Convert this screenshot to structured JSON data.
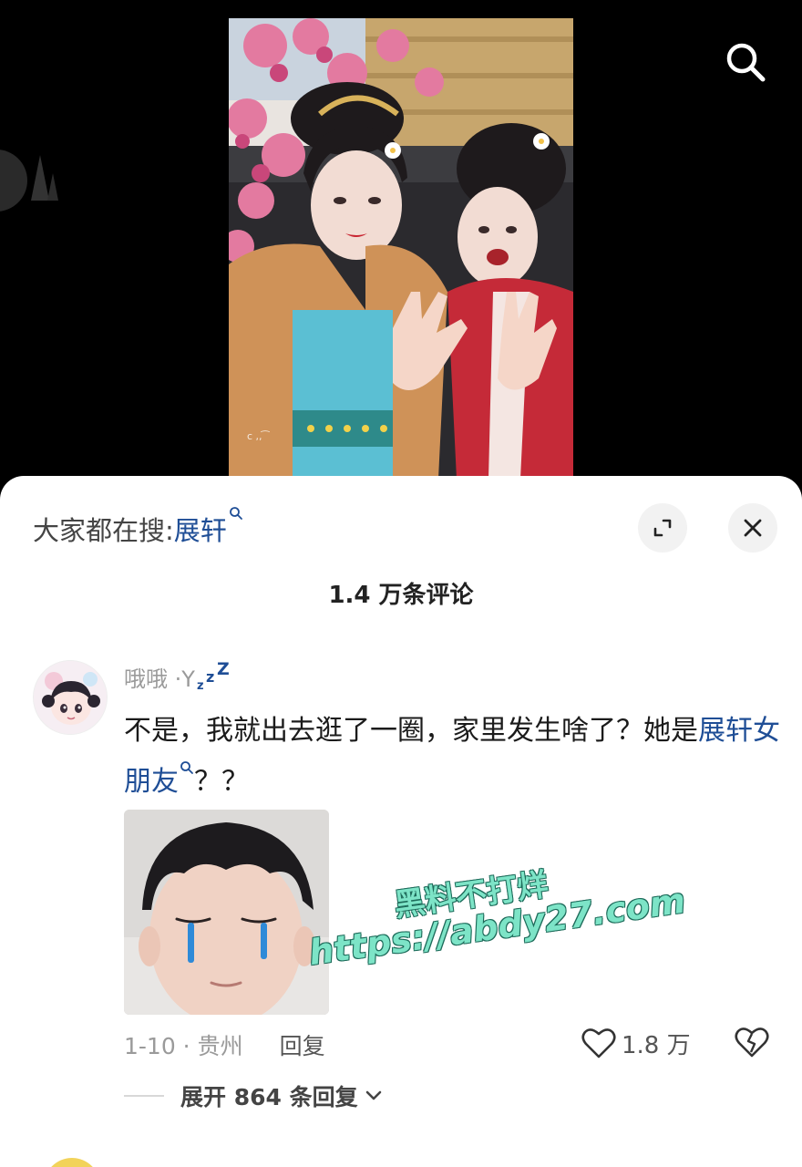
{
  "video": {
    "icons": {
      "search": "search-icon",
      "side_logo": "logo-icon"
    }
  },
  "comments_panel": {
    "hot_search": {
      "prefix": "大家都在搜:",
      "keyword": "展轩"
    },
    "buttons": {
      "expand": "expand-icon",
      "close": "close-icon"
    },
    "count_label": "1.4 万条评论"
  },
  "comment": {
    "username": "哦哦 ·Y",
    "username_emoji": "zzz-icon",
    "text_before": "不是，我就出去逛了一圈，家里发生啥了？她是",
    "text_keyword": "展轩女朋友",
    "text_after": "？？",
    "date_location": "1-10 · 贵州",
    "reply_label": "回复",
    "like_count": "1.8 万",
    "expand_replies": "展开 864 条回复"
  },
  "watermark": {
    "line1": "黑料不打烊",
    "line2": "https://abdy27.com"
  },
  "colors": {
    "link": "#1f4e96",
    "muted": "#9a9a9a",
    "sheet_bg": "#ffffff",
    "page_bg": "#000000"
  }
}
